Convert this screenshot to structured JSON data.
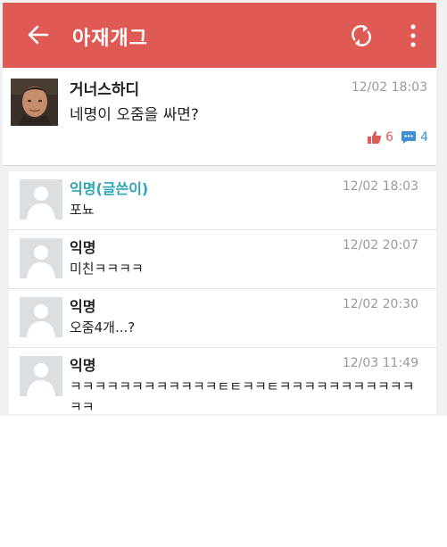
{
  "appbar": {
    "title": "아재개그"
  },
  "post": {
    "author": "거너스하디",
    "time": "12/02 18:03",
    "body": "네명이 오줌을 싸면?",
    "likes": "6",
    "comments_count": "4"
  },
  "comments": [
    {
      "name": "익명(글쓴이)",
      "time": "12/02 18:03",
      "text": "포뇨"
    },
    {
      "name": "익명",
      "time": "12/02 20:07",
      "text": "미친ㅋㅋㅋㅋ"
    },
    {
      "name": "익명",
      "time": "12/02 20:30",
      "text": "오줌4개...?"
    },
    {
      "name": "익명",
      "time": "12/03 11:49",
      "text": "ㅋㅋㅋㅋㅋㅋㅋㅋㅋㅋㅋㅋㅌㅌㅋㅋㅌㅋㅋㅋㅋㅋㅋㅋㅋㅋㅋㅋㅋㅋ"
    }
  ],
  "colors": {
    "appbar": "#e05a55",
    "op_name": "#2aa6b6",
    "like": "#e05a55",
    "comment_icon": "#3f8fd0"
  },
  "icons": [
    "back-arrow-icon",
    "refresh-icon",
    "more-vert-icon",
    "thumbs-up-icon",
    "comment-bubble-icon",
    "default-avatar-icon"
  ]
}
